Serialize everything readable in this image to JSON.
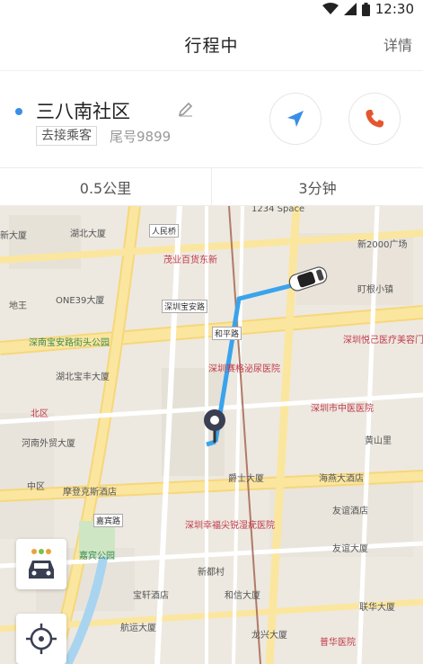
{
  "status_bar": {
    "time": "12:30"
  },
  "header": {
    "title": "行程中",
    "detail": "详情"
  },
  "destination": {
    "name": "三八南社区",
    "tag": "去接乘客",
    "tail_number": "尾号9899"
  },
  "stats": {
    "distance": "0.5公里",
    "duration": "3分钟"
  },
  "colors": {
    "accent_blue": "#3a8ee6",
    "call_red": "#e4562f",
    "route_blue": "#3aa3ec"
  },
  "icons": {
    "wifi": "wifi-icon",
    "signal": "signal-icon",
    "battery": "battery-icon",
    "edit": "pencil-icon",
    "navigate": "navigation-arrow-icon",
    "call": "phone-icon",
    "car": "car-icon",
    "locate": "crosshair-icon"
  },
  "map": {
    "labels": [
      "湖北大厦",
      "新大厦",
      "地王",
      "ONE39大厦",
      "深南宝安路街头公园",
      "茂业百货东新",
      "人民桥",
      "1234 Space",
      "新2000广场",
      "盯根小镇",
      "深圳悦己医疗美容门诊",
      "湖北宝丰大厦",
      "深圳赛格泌尿医院",
      "深圳市中医医院",
      "河南外贸大厦",
      "中区",
      "摩登克斯酒店",
      "嘉宾路",
      "嘉宾公园",
      "深圳幸福尖锐湿疣医院",
      "友谊酒店",
      "新都村",
      "宝轩酒店",
      "和信大厦",
      "联华大厦",
      "航运大厦",
      "龙兴大厦",
      "普华医院",
      "爵士大厦",
      "海燕大酒店",
      "友谊大厦",
      "黄山里",
      "北区",
      "深圳宝安路",
      "和平路"
    ]
  }
}
